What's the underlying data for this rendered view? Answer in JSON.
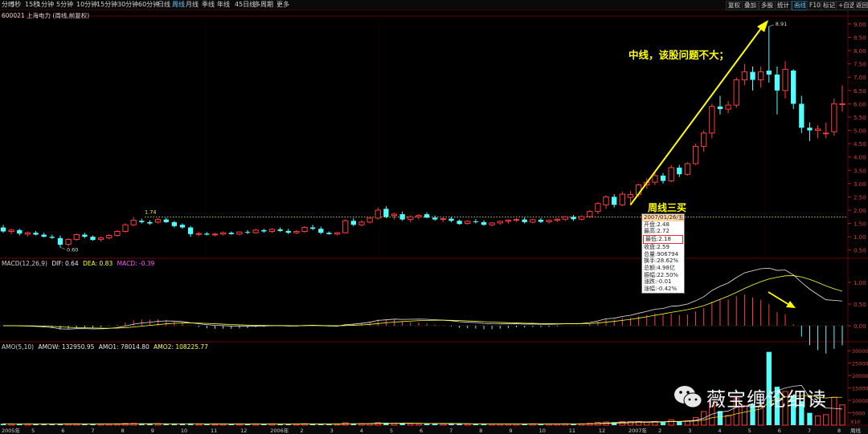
{
  "toolbar": {
    "left": [
      "分时",
      "5秒",
      "15秒",
      "1分钟",
      "5分钟",
      "10分钟",
      "15分钟",
      "30分钟",
      "60分钟",
      "日线",
      "周线",
      "月线",
      "季线",
      "年线",
      "45日线",
      "多周期",
      "更多"
    ],
    "active": "周线",
    "right": [
      "复权",
      "叠加",
      "多股",
      "统计",
      "画线",
      "F10",
      "标记",
      "+自选",
      "返回"
    ],
    "right_active": "画线"
  },
  "stock": "600021 上海电力 (周线,前复权)",
  "annotations": {
    "main_text": "中线，该股问题不大；",
    "buy_label": "周线三买",
    "high_label": "8.91",
    "low_label": "0.60",
    "ref_label": "1.74"
  },
  "tooltip": [
    {
      "k": "date",
      "t": "2007/01/26/五"
    },
    {
      "k": "open",
      "t": "开盘:2.48"
    },
    {
      "k": "high",
      "t": "最高:2.72"
    },
    {
      "k": "low",
      "t": "最低:2.18"
    },
    {
      "k": "close",
      "t": "收盘:2.59"
    },
    {
      "k": "vol",
      "t": "总量:906794"
    },
    {
      "k": "turnover",
      "t": "换手:28.62%"
    },
    {
      "k": "amount",
      "t": "总额:4.98亿"
    },
    {
      "k": "amplitude",
      "t": "振幅:22.50%"
    },
    {
      "k": "change",
      "t": "涨跌:-0.01"
    },
    {
      "k": "pct",
      "t": "涨幅:-0.42%"
    }
  ],
  "macd": {
    "title": "MACD(12,26,9)",
    "dif": "DIF: 0.64",
    "dea": "DEA: 0.83",
    "macd": "MACD: -0.39"
  },
  "amo": {
    "title": "AMO(5,10)",
    "amow": "AMOW: 132950.95",
    "amo1": "AMO1: 78014.80",
    "amo2": "AMO2: 108225.77"
  },
  "bottom_axis": {
    "labels": [
      "2005年",
      "5",
      "6",
      "7",
      "8",
      "9",
      "10",
      "11",
      "12",
      "2006年",
      "2",
      "3",
      "4",
      "5",
      "6",
      "7",
      "8",
      "9",
      "10",
      "11",
      "12",
      "2007年",
      "2",
      "3",
      "4",
      "5",
      "6",
      "7",
      "8"
    ],
    "tag": "周线"
  },
  "watermark": "薇宝缠论细读",
  "colors": {
    "up": "#ff3c3c",
    "down": "#54ffff",
    "dif": "#e8e8e8",
    "dea": "#ffff33",
    "amo1": "#ffffff",
    "amo2": "#ffff33",
    "arrow": "#ffff00",
    "macd_dea_label": "#ffff33",
    "macd_macd_label": "#ff55ff"
  },
  "chart_data": {
    "type": "candlestick",
    "y_ticks": [
      "9.00",
      "8.50",
      "8.00",
      "7.50",
      "7.00",
      "6.50",
      "6.00",
      "5.50",
      "5.00",
      "4.50",
      "4.00",
      "3.50",
      "3.00",
      "2.50",
      "2.00",
      "1.50",
      "1.00",
      "0.50"
    ],
    "ylim": [
      0.25,
      9.3
    ],
    "macd_ticks": [
      "1.00",
      "0.50",
      "0.00"
    ],
    "macd_ylim": [
      -0.35,
      1.35
    ],
    "amo_ticks": [
      "30000",
      "25000",
      "20000",
      "15000",
      "10000",
      "5000"
    ],
    "amo_ylim": [
      0,
      31000
    ],
    "ref_line": 1.74,
    "candles": [
      [
        1.35,
        1.45,
        1.15,
        1.2
      ],
      [
        1.2,
        1.3,
        1.1,
        1.25
      ],
      [
        1.25,
        1.3,
        1.05,
        1.12
      ],
      [
        1.1,
        1.2,
        1.02,
        1.15
      ],
      [
        1.15,
        1.22,
        1.05,
        1.08
      ],
      [
        1.08,
        1.15,
        0.98,
        1.0
      ],
      [
        1.0,
        1.08,
        0.92,
        0.96
      ],
      [
        0.95,
        1.05,
        0.6,
        0.7
      ],
      [
        0.72,
        0.95,
        0.65,
        0.9
      ],
      [
        0.9,
        1.12,
        0.85,
        1.08
      ],
      [
        1.08,
        1.15,
        0.95,
        1.0
      ],
      [
        1.0,
        1.05,
        0.85,
        0.88
      ],
      [
        0.9,
        1.0,
        0.82,
        0.96
      ],
      [
        0.96,
        1.1,
        0.9,
        1.05
      ],
      [
        1.05,
        1.25,
        1.0,
        1.2
      ],
      [
        1.2,
        1.5,
        1.15,
        1.45
      ],
      [
        1.45,
        1.74,
        1.4,
        1.62
      ],
      [
        1.6,
        1.68,
        1.5,
        1.55
      ],
      [
        1.55,
        1.62,
        1.45,
        1.5
      ],
      [
        1.55,
        1.7,
        1.5,
        1.65
      ],
      [
        1.65,
        1.72,
        1.52,
        1.55
      ],
      [
        1.55,
        1.6,
        1.35,
        1.4
      ],
      [
        1.45,
        1.5,
        1.3,
        1.35
      ],
      [
        1.35,
        1.4,
        1.0,
        1.1
      ],
      [
        1.1,
        1.18,
        1.02,
        1.12
      ],
      [
        1.12,
        1.18,
        1.05,
        1.08
      ],
      [
        1.08,
        1.15,
        1.02,
        1.1
      ],
      [
        1.1,
        1.2,
        1.05,
        1.15
      ],
      [
        1.15,
        1.2,
        1.08,
        1.1
      ],
      [
        1.1,
        1.2,
        1.05,
        1.18
      ],
      [
        1.18,
        1.25,
        1.1,
        1.15
      ],
      [
        1.15,
        1.3,
        1.12,
        1.25
      ],
      [
        1.25,
        1.3,
        1.15,
        1.2
      ],
      [
        1.2,
        1.32,
        1.15,
        1.28
      ],
      [
        1.28,
        1.35,
        1.18,
        1.22
      ],
      [
        1.22,
        1.3,
        1.1,
        1.15
      ],
      [
        1.15,
        1.25,
        1.1,
        1.2
      ],
      [
        1.2,
        1.4,
        1.15,
        1.35
      ],
      [
        1.35,
        1.45,
        1.25,
        1.3
      ],
      [
        1.3,
        1.38,
        1.1,
        1.15
      ],
      [
        1.15,
        1.2,
        1.08,
        1.1
      ],
      [
        1.1,
        1.18,
        1.05,
        1.15
      ],
      [
        1.15,
        1.65,
        1.12,
        1.6
      ],
      [
        1.6,
        1.7,
        1.4,
        1.45
      ],
      [
        1.45,
        1.62,
        1.4,
        1.55
      ],
      [
        1.55,
        1.75,
        1.5,
        1.7
      ],
      [
        1.7,
        2.1,
        1.65,
        2.0
      ],
      [
        2.05,
        2.15,
        1.7,
        1.75
      ],
      [
        1.8,
        1.9,
        1.65,
        1.85
      ],
      [
        1.85,
        1.95,
        1.6,
        1.65
      ],
      [
        1.65,
        1.8,
        1.55,
        1.75
      ],
      [
        1.75,
        1.85,
        1.65,
        1.8
      ],
      [
        1.85,
        1.92,
        1.7,
        1.72
      ],
      [
        1.72,
        1.8,
        1.6,
        1.65
      ],
      [
        1.65,
        1.72,
        1.55,
        1.68
      ],
      [
        1.68,
        1.75,
        1.55,
        1.6
      ],
      [
        1.6,
        1.65,
        1.45,
        1.48
      ],
      [
        1.5,
        1.62,
        1.45,
        1.58
      ],
      [
        1.58,
        1.66,
        1.5,
        1.55
      ],
      [
        1.55,
        1.62,
        1.42,
        1.45
      ],
      [
        1.45,
        1.55,
        1.4,
        1.52
      ],
      [
        1.52,
        1.6,
        1.45,
        1.58
      ],
      [
        1.58,
        1.65,
        1.5,
        1.62
      ],
      [
        1.62,
        1.7,
        1.55,
        1.65
      ],
      [
        1.65,
        1.72,
        1.5,
        1.55
      ],
      [
        1.55,
        1.68,
        1.5,
        1.64
      ],
      [
        1.64,
        1.7,
        1.52,
        1.56
      ],
      [
        1.56,
        1.65,
        1.5,
        1.62
      ],
      [
        1.62,
        1.7,
        1.55,
        1.66
      ],
      [
        1.66,
        1.78,
        1.6,
        1.75
      ],
      [
        1.75,
        1.82,
        1.6,
        1.66
      ],
      [
        1.66,
        1.8,
        1.62,
        1.76
      ],
      [
        1.76,
        2.0,
        1.7,
        1.95
      ],
      [
        1.95,
        2.3,
        1.85,
        2.25
      ],
      [
        2.2,
        2.55,
        2.05,
        2.5
      ],
      [
        2.5,
        2.6,
        2.1,
        2.2
      ],
      [
        2.2,
        2.7,
        2.15,
        2.6
      ],
      [
        2.48,
        2.72,
        2.18,
        2.59
      ],
      [
        2.59,
        3.0,
        2.5,
        2.95
      ],
      [
        2.95,
        3.2,
        2.8,
        3.05
      ],
      [
        3.05,
        3.4,
        2.95,
        3.3
      ],
      [
        3.3,
        3.4,
        3.0,
        3.1
      ],
      [
        3.1,
        3.7,
        3.05,
        3.6
      ],
      [
        3.6,
        3.7,
        3.25,
        3.35
      ],
      [
        3.35,
        3.8,
        3.3,
        3.75
      ],
      [
        3.75,
        4.5,
        3.7,
        4.4
      ],
      [
        4.4,
        5.0,
        4.2,
        4.9
      ],
      [
        4.9,
        6.0,
        4.7,
        5.9
      ],
      [
        5.9,
        6.3,
        5.6,
        5.8
      ],
      [
        5.8,
        6.1,
        5.65,
        5.95
      ],
      [
        5.95,
        7.0,
        5.85,
        6.9
      ],
      [
        6.9,
        7.5,
        6.7,
        7.2
      ],
      [
        7.2,
        7.4,
        6.5,
        6.9
      ],
      [
        6.9,
        7.4,
        6.6,
        7.2
      ],
      [
        7.25,
        8.91,
        6.8,
        7.1
      ],
      [
        7.1,
        7.4,
        5.6,
        6.5
      ],
      [
        6.5,
        7.6,
        6.2,
        7.3
      ],
      [
        7.25,
        7.3,
        5.8,
        6.0
      ],
      [
        6.0,
        6.3,
        4.9,
        5.1
      ],
      [
        5.1,
        5.3,
        4.6,
        5.0
      ],
      [
        5.0,
        5.2,
        4.7,
        5.05
      ],
      [
        4.9,
        5.3,
        4.7,
        4.9
      ],
      [
        4.95,
        6.2,
        4.8,
        6.0
      ],
      [
        6.0,
        6.7,
        5.7,
        6.0
      ]
    ]
  }
}
